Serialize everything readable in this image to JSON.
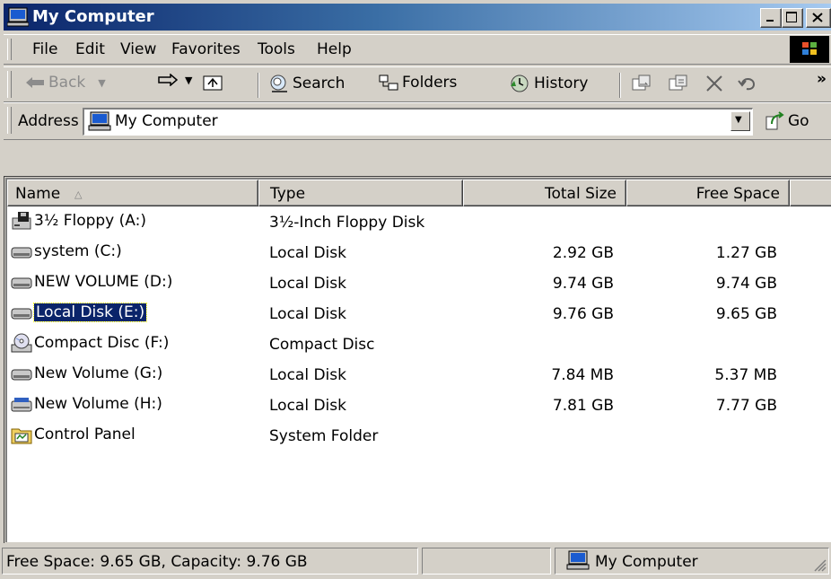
{
  "window": {
    "title": "My Computer"
  },
  "menu": [
    "File",
    "Edit",
    "View",
    "Favorites",
    "Tools",
    "Help"
  ],
  "toolbar": {
    "back": "Back",
    "search": "Search",
    "folders": "Folders",
    "history": "History",
    "more": "»"
  },
  "address": {
    "label": "Address",
    "value": "My Computer",
    "go": "Go"
  },
  "columns": [
    "Name",
    "Type",
    "Total Size",
    "Free Space"
  ],
  "items": [
    {
      "icon": "floppy-drive-icon",
      "name": "3½ Floppy (A:)",
      "type": "3½-Inch Floppy Disk",
      "total": "",
      "free": ""
    },
    {
      "icon": "hard-disk-icon",
      "name": "system (C:)",
      "type": "Local Disk",
      "total": "2.92 GB",
      "free": "1.27 GB"
    },
    {
      "icon": "hard-disk-icon",
      "name": "NEW VOLUME (D:)",
      "type": "Local Disk",
      "total": "9.74 GB",
      "free": "9.74 GB"
    },
    {
      "icon": "hard-disk-icon",
      "name": "Local Disk (E:)",
      "type": "Local Disk",
      "total": "9.76 GB",
      "free": "9.65 GB",
      "selected": true
    },
    {
      "icon": "cd-drive-icon",
      "name": "Compact Disc (F:)",
      "type": "Compact Disc",
      "total": "",
      "free": ""
    },
    {
      "icon": "hard-disk-icon",
      "name": "New Volume (G:)",
      "type": "Local Disk",
      "total": "7.84 MB",
      "free": "5.37 MB"
    },
    {
      "icon": "removable-disk-icon",
      "name": "New Volume (H:)",
      "type": "Local Disk",
      "total": "7.81 GB",
      "free": "7.77 GB"
    },
    {
      "icon": "control-panel-icon",
      "name": "Control Panel",
      "type": "System Folder",
      "total": "",
      "free": ""
    }
  ],
  "status": {
    "info": "Free Space: 9.65 GB, Capacity: 9.76 GB",
    "zone": "My Computer"
  },
  "colors": {
    "title_start": "#0a246a",
    "title_end": "#a6caf0",
    "face": "#d4d0c8",
    "selection": "#0a246a"
  }
}
